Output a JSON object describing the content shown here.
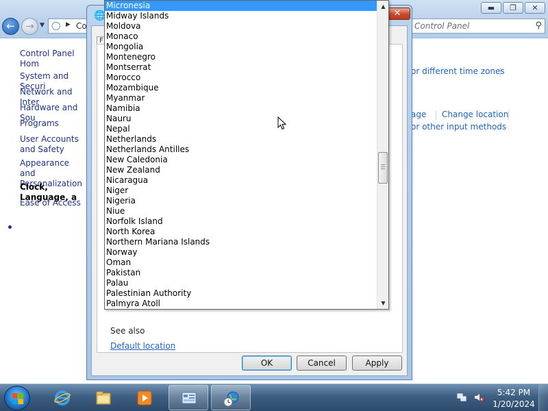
{
  "control_panel": {
    "breadcrumb": "Co",
    "search_placeholder": "Control Panel",
    "sidebar": [
      {
        "label": "Control Panel Hom"
      },
      {
        "label": "System and Securi"
      },
      {
        "label": "Network and Inter"
      },
      {
        "label": "Hardware and Sou"
      },
      {
        "label": "Programs"
      },
      {
        "label": "User Accounts and Safety"
      },
      {
        "label": "Appearance and Personalization"
      },
      {
        "label": "Clock, Language, a"
      },
      {
        "label": "Ease of Access"
      }
    ],
    "links": {
      "time_zones": "or different time zones",
      "language": "age",
      "change_location": "Change location",
      "input_methods": "or other input methods"
    }
  },
  "dialog": {
    "tab_stub": "F",
    "see_also": "See also",
    "default_location": "Default location",
    "ok_label": "OK",
    "cancel_label": "Cancel",
    "apply_label": "Apply"
  },
  "dropdown": {
    "selected": "Micronesia",
    "items": [
      "Micronesia",
      "Midway Islands",
      "Moldova",
      "Monaco",
      "Mongolia",
      "Montenegro",
      "Montserrat",
      "Morocco",
      "Mozambique",
      "Myanmar",
      "Namibia",
      "Nauru",
      "Nepal",
      "Netherlands",
      "Netherlands Antilles",
      "New Caledonia",
      "New Zealand",
      "Nicaragua",
      "Niger",
      "Nigeria",
      "Niue",
      "Norfolk Island",
      "North Korea",
      "Northern Mariana Islands",
      "Norway",
      "Oman",
      "Pakistan",
      "Palau",
      "Palestinian Authority",
      "Palmyra Atoll"
    ],
    "scroll_position": 0.55
  },
  "taskbar": {
    "time": "5:42 PM",
    "date": "1/20/2024",
    "apps": [
      "internet-explorer",
      "windows-explorer",
      "windows-media-player",
      "control-panel",
      "region-settings"
    ]
  },
  "colors": {
    "selection": "#3399ff",
    "link": "#1e64c8"
  }
}
